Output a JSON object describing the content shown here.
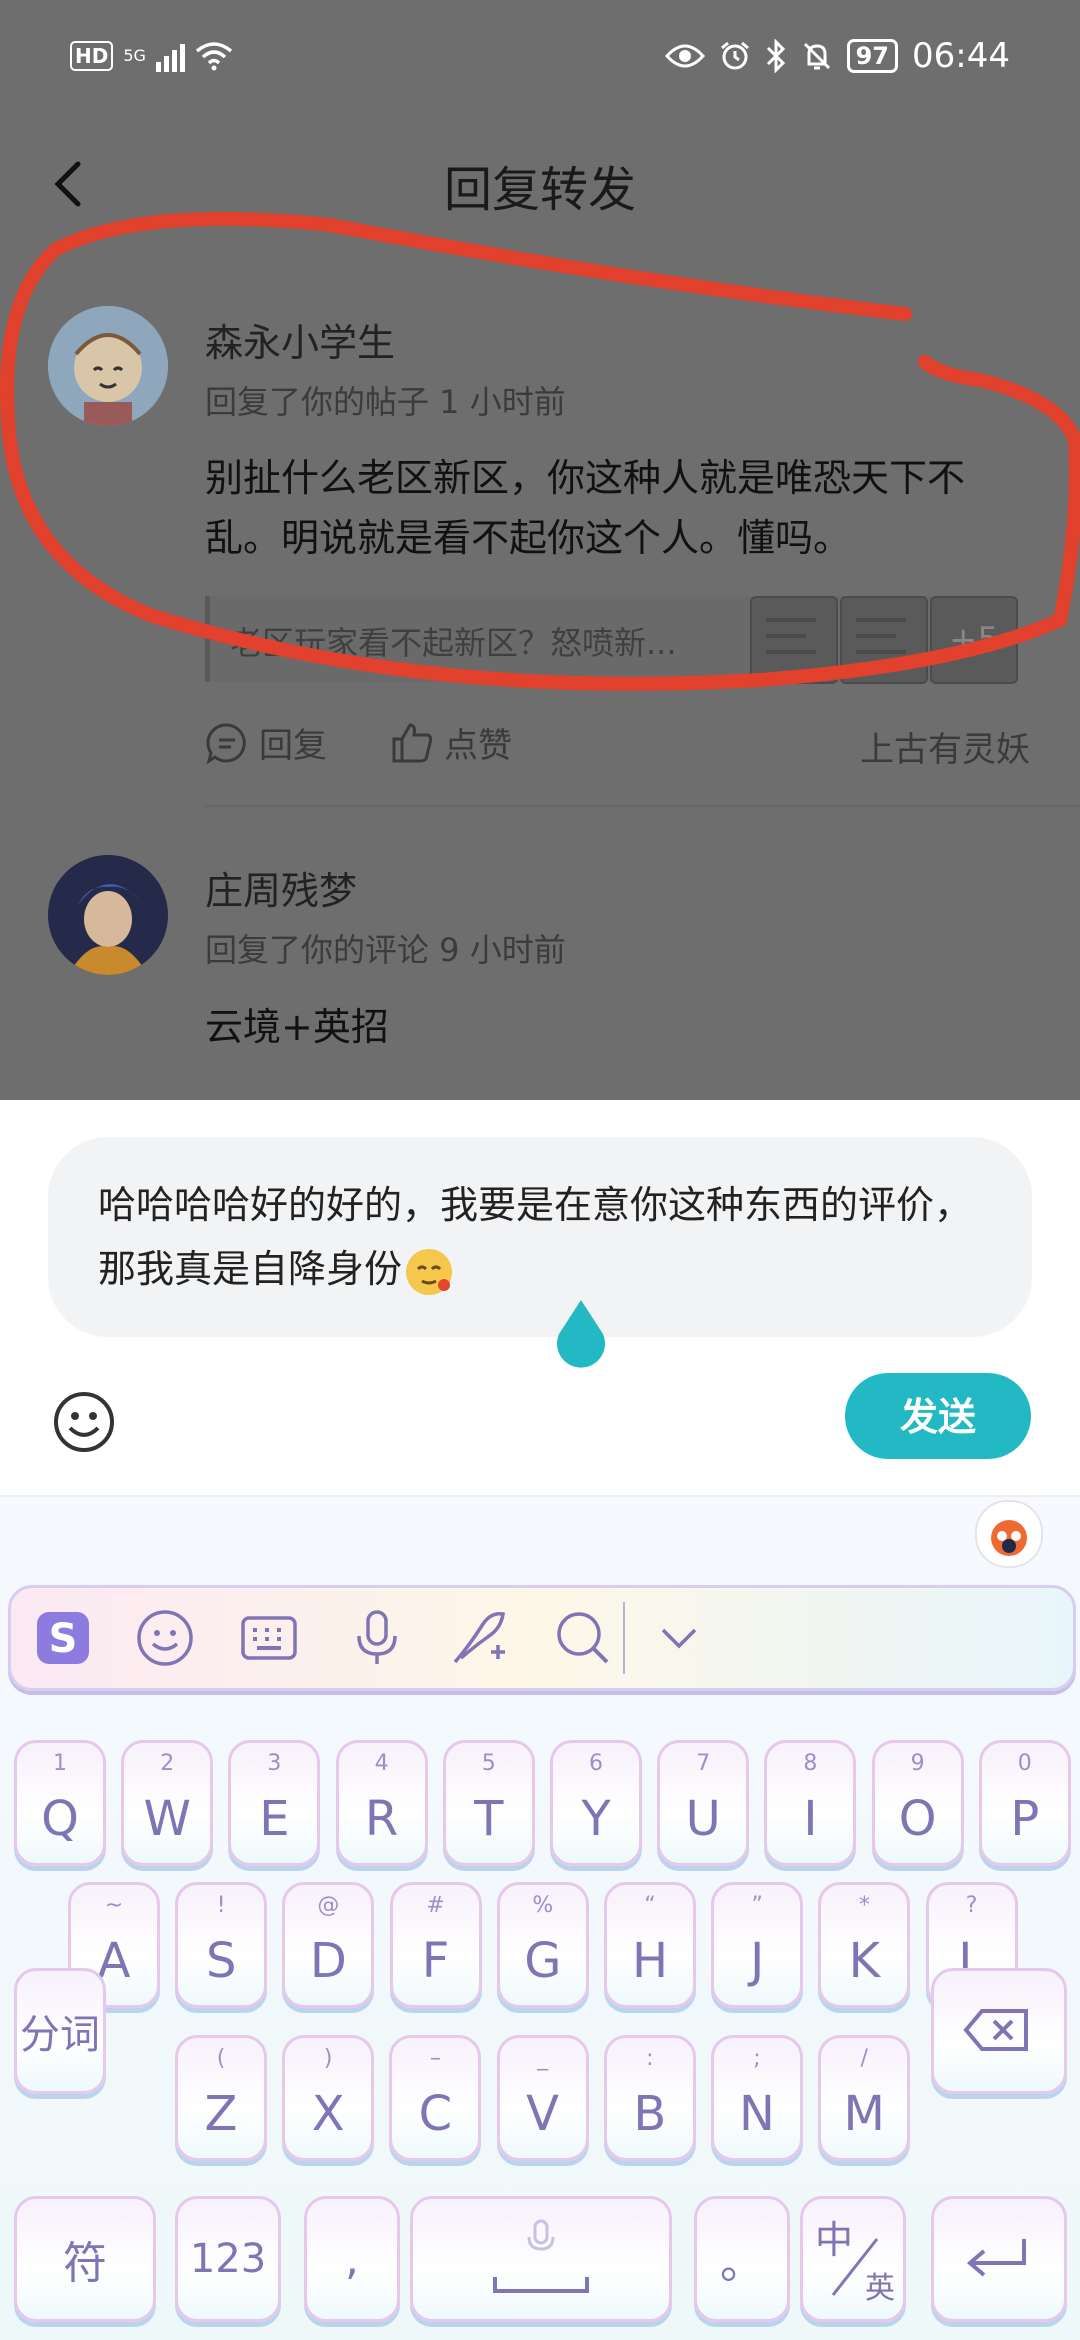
{
  "status_bar": {
    "network_badge": "HD",
    "signal_type": "5G",
    "battery": "97",
    "time": "06:44"
  },
  "header": {
    "title": "回复转发"
  },
  "notifications": [
    {
      "username": "森永小学生",
      "meta": "回复了你的帖子 1 小时前",
      "text": "别扯什么老区新区，你这种人就是唯恐天下不乱。明说就是看不起你这个人。懂吗。",
      "quote": "老区玩家看不起新区？怒喷新...",
      "quote_more": "+5",
      "reply_label": "回复",
      "like_label": "点赞",
      "game": "上古有灵妖"
    },
    {
      "username": "庄周残梦",
      "meta": "回复了你的评论 9 小时前",
      "text": "云境+英招"
    }
  ],
  "composer": {
    "text": "哈哈哈哈好的好的，我要是在意你这种东西的评价，那我真是自降身份",
    "send_label": "发送"
  },
  "keyboard": {
    "row1": [
      {
        "hint": "1",
        "label": "Q"
      },
      {
        "hint": "2",
        "label": "W"
      },
      {
        "hint": "3",
        "label": "E"
      },
      {
        "hint": "4",
        "label": "R"
      },
      {
        "hint": "5",
        "label": "T"
      },
      {
        "hint": "6",
        "label": "Y"
      },
      {
        "hint": "7",
        "label": "U"
      },
      {
        "hint": "8",
        "label": "I"
      },
      {
        "hint": "9",
        "label": "O"
      },
      {
        "hint": "0",
        "label": "P"
      }
    ],
    "row2": [
      {
        "hint": "~",
        "label": "A"
      },
      {
        "hint": "!",
        "label": "S"
      },
      {
        "hint": "@",
        "label": "D"
      },
      {
        "hint": "#",
        "label": "F"
      },
      {
        "hint": "%",
        "label": "G"
      },
      {
        "hint": "“",
        "label": "H"
      },
      {
        "hint": "”",
        "label": "J"
      },
      {
        "hint": "*",
        "label": "K"
      },
      {
        "hint": "?",
        "label": "L"
      }
    ],
    "row3": [
      {
        "hint": "(",
        "label": "Z"
      },
      {
        "hint": ")",
        "label": "X"
      },
      {
        "hint": "–",
        "label": "C"
      },
      {
        "hint": "_",
        "label": "V"
      },
      {
        "hint": ":",
        "label": "B"
      },
      {
        "hint": ";",
        "label": "N"
      },
      {
        "hint": "/",
        "label": "M"
      }
    ],
    "segment_label": "分词",
    "symbol_label": "符",
    "number_label": "123",
    "comma_label": ",",
    "period_label": "。",
    "lang_top": "中",
    "lang_bottom": "英"
  }
}
